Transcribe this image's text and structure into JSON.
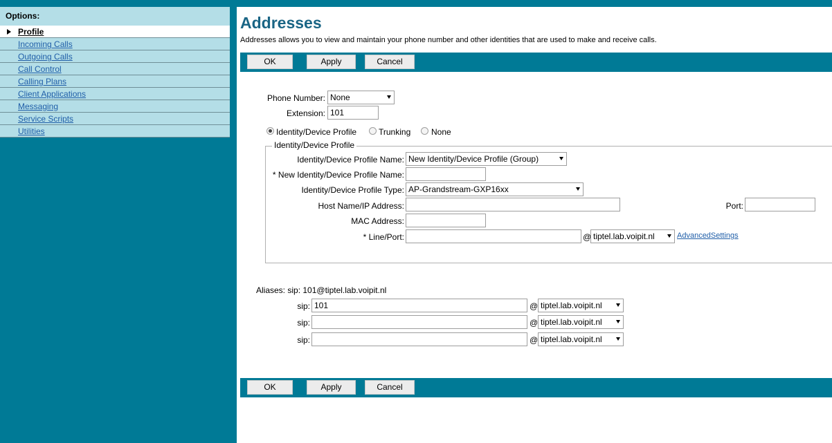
{
  "sidebar": {
    "heading": "Options:",
    "items": [
      {
        "label": "Profile"
      },
      {
        "label": "Incoming Calls"
      },
      {
        "label": "Outgoing Calls"
      },
      {
        "label": "Call Control"
      },
      {
        "label": "Calling Plans"
      },
      {
        "label": "Client Applications"
      },
      {
        "label": "Messaging"
      },
      {
        "label": "Service Scripts"
      },
      {
        "label": "Utilities"
      }
    ]
  },
  "page": {
    "title": "Addresses",
    "description": "Addresses allows you to view and maintain your phone number and other identities that are used to make and receive calls."
  },
  "buttons": {
    "ok": "OK",
    "apply": "Apply",
    "cancel": "Cancel"
  },
  "form": {
    "phone_number_label": "Phone Number:",
    "phone_number_value": "None",
    "extension_label": "Extension:",
    "extension_value": "101",
    "radio_identity": "Identity/Device Profile",
    "radio_trunking": "Trunking",
    "radio_none": "None",
    "group_legend": "Identity/Device Profile",
    "profile_name_label": "Identity/Device Profile Name:",
    "profile_name_value": "New Identity/Device Profile (Group)",
    "new_profile_name_label": "* New Identity/Device Profile Name:",
    "new_profile_name_value": "",
    "profile_type_label": "Identity/Device Profile Type:",
    "profile_type_value": "AP-Grandstream-GXP16xx",
    "host_label": "Host Name/IP Address:",
    "host_value": "",
    "port_label": "Port:",
    "port_value": "",
    "mac_label": "MAC Address:",
    "mac_value": "",
    "lineport_label": "* Line/Port:",
    "lineport_value": "",
    "at": "@",
    "lineport_domain": "tiptel.lab.voipit.nl",
    "advanced_link": "AdvancedSettings"
  },
  "aliases": {
    "label": "Aliases: sip: 101@tiptel.lab.voipit.nl",
    "sip_label": "sip:",
    "at": "@",
    "rows": [
      {
        "value": "101",
        "domain": "tiptel.lab.voipit.nl"
      },
      {
        "value": "",
        "domain": "tiptel.lab.voipit.nl"
      },
      {
        "value": "",
        "domain": "tiptel.lab.voipit.nl"
      }
    ]
  }
}
